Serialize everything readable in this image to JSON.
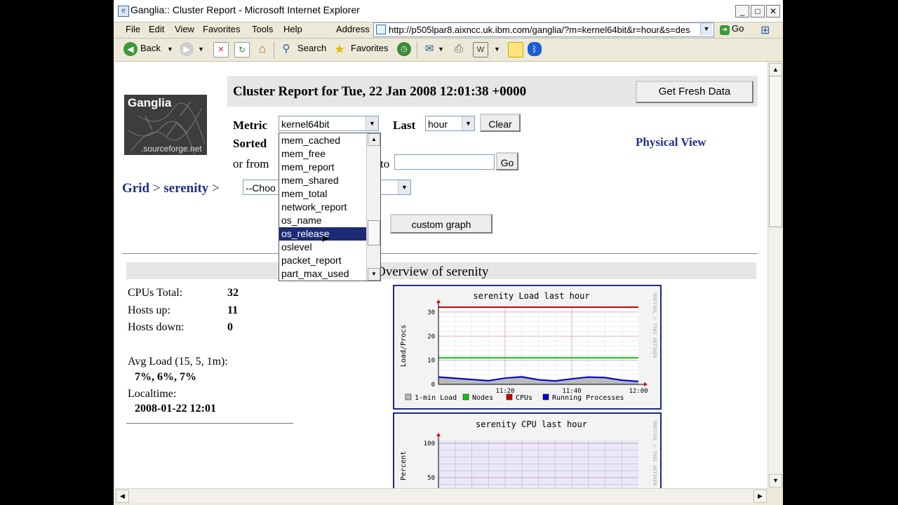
{
  "window": {
    "title": "Ganglia:: Cluster Report - Microsoft Internet Explorer",
    "controls": [
      "_",
      "□",
      "✕"
    ]
  },
  "menu": [
    "File",
    "Edit",
    "View",
    "Favorites",
    "Tools",
    "Help"
  ],
  "address": {
    "label": "Address",
    "url": "http://p505lpar8.aixncc.uk.ibm.com/ganglia/?m=kernel64bit&r=hour&s=des",
    "go_label": "Go"
  },
  "toolbar": {
    "back": "Back",
    "search": "Search",
    "favorites": "Favorites"
  },
  "page": {
    "logo": {
      "brand": "Ganglia",
      "sub": ".sourceforge.net"
    },
    "header_title": "Cluster Report for Tue, 22 Jan 2008 12:01:38 +0000",
    "fresh_button": "Get Fresh Data",
    "metric_label": "Metric",
    "metric_value": "kernel64bit",
    "last_label": "Last",
    "last_value": "hour",
    "clear_button": "Clear",
    "sorted_label": "Sorted",
    "or_from_label": "or from",
    "to_label": "to",
    "go_button": "Go",
    "physical_view": "Physical View",
    "breadcrumb": {
      "grid": "Grid",
      "sep1": " > ",
      "cluster": "serenity",
      "sep2": " >"
    },
    "choose_node": "--Choo",
    "custom_graph_button": "custom graph",
    "overview_title": "Overview of serenity"
  },
  "dropdown": {
    "items": [
      "mem_cached",
      "mem_free",
      "mem_report",
      "mem_shared",
      "mem_total",
      "network_report",
      "os_name",
      "os_release",
      "oslevel",
      "packet_report",
      "part_max_used"
    ],
    "selected_index": 7
  },
  "stats": {
    "cpus_label": "CPUs Total:",
    "cpus": "32",
    "hosts_up_label": "Hosts up:",
    "hosts_up": "11",
    "hosts_down_label": "Hosts down:",
    "hosts_down": "0",
    "avg_load_label": "Avg Load (15, 5, 1m):",
    "avg_load": "7%, 6%, 7%",
    "localtime_label": "Localtime:",
    "localtime": "2008-01-22 12:01"
  },
  "chart_data": [
    {
      "type": "line",
      "title": "serenity Load last hour",
      "ylabel": "Load/Procs",
      "side_text": "RRDTOOL / TOBI OETIKER",
      "x_ticks": [
        "11:20",
        "11:40",
        "12:00"
      ],
      "y_ticks": [
        0,
        10,
        20,
        30
      ],
      "ylim": [
        0,
        32
      ],
      "series": [
        {
          "name": "CPUs",
          "color": "#cc0000",
          "values": [
            32,
            32,
            32,
            32,
            32,
            32,
            32,
            32,
            32,
            32,
            32,
            32,
            32
          ]
        },
        {
          "name": "Nodes",
          "color": "#00cc00",
          "values": [
            11,
            11,
            11,
            11,
            11,
            11,
            11,
            11,
            11,
            11,
            11,
            11,
            11
          ]
        },
        {
          "name": "1-min Load",
          "color": "#bbbbbb",
          "values": [
            3.5,
            3.0,
            2.4,
            1.9,
            2.9,
            3.6,
            2.3,
            1.8,
            2.6,
            3.4,
            3.2,
            2.1,
            1.6
          ]
        },
        {
          "name": "Running Processes",
          "color": "#0000cc",
          "values": [
            3.0,
            2.5,
            2.0,
            1.5,
            2.6,
            3.1,
            1.9,
            1.4,
            2.3,
            3.0,
            2.8,
            1.7,
            1.2
          ]
        }
      ],
      "legend": [
        "1-min Load",
        "Nodes",
        "CPUs",
        "Running Processes"
      ]
    },
    {
      "type": "area",
      "title": "serenity CPU last hour",
      "ylabel": "Percent",
      "side_text": "RRDTOOL / TOBI OETIKER",
      "y_ticks": [
        50,
        100
      ],
      "ylim": [
        0,
        100
      ]
    }
  ]
}
